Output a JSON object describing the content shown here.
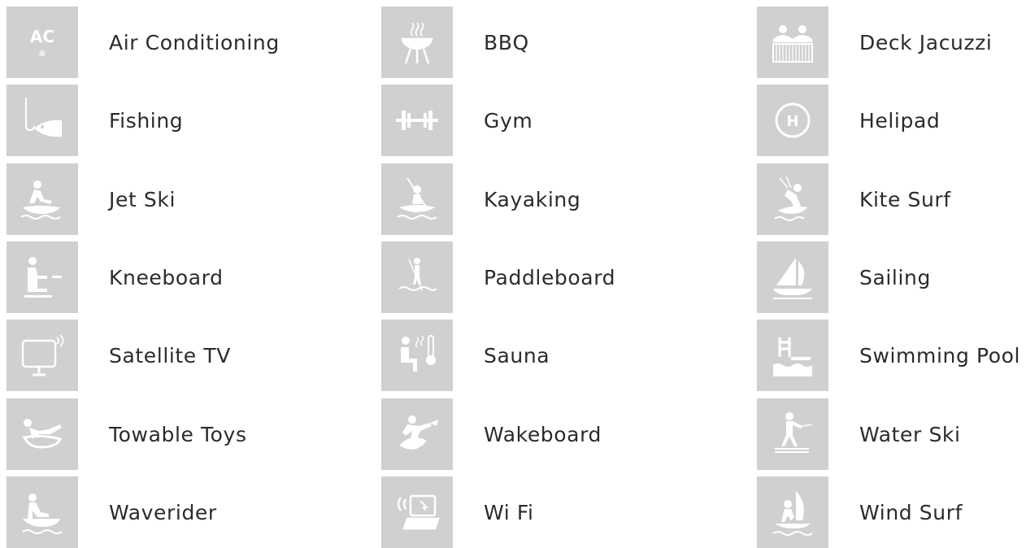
{
  "amenities": [
    {
      "label": "Air Conditioning",
      "icon": "air-conditioning-icon"
    },
    {
      "label": "BBQ",
      "icon": "bbq-icon"
    },
    {
      "label": "Deck Jacuzzi",
      "icon": "deck-jacuzzi-icon"
    },
    {
      "label": "Fishing",
      "icon": "fishing-icon"
    },
    {
      "label": "Gym",
      "icon": "gym-icon"
    },
    {
      "label": "Helipad",
      "icon": "helipad-icon"
    },
    {
      "label": "Jet Ski",
      "icon": "jet-ski-icon"
    },
    {
      "label": "Kayaking",
      "icon": "kayaking-icon"
    },
    {
      "label": "Kite Surf",
      "icon": "kite-surf-icon"
    },
    {
      "label": "Kneeboard",
      "icon": "kneeboard-icon"
    },
    {
      "label": "Paddleboard",
      "icon": "paddleboard-icon"
    },
    {
      "label": "Sailing",
      "icon": "sailing-icon"
    },
    {
      "label": "Satellite TV",
      "icon": "satellite-tv-icon"
    },
    {
      "label": "Sauna",
      "icon": "sauna-icon"
    },
    {
      "label": "Swimming Pool",
      "icon": "swimming-pool-icon"
    },
    {
      "label": "Towable Toys",
      "icon": "towable-toys-icon"
    },
    {
      "label": "Wakeboard",
      "icon": "wakeboard-icon"
    },
    {
      "label": "Water Ski",
      "icon": "water-ski-icon"
    },
    {
      "label": "Waverider",
      "icon": "waverider-icon"
    },
    {
      "label": "Wi Fi",
      "icon": "wifi-icon"
    },
    {
      "label": "Wind Surf",
      "icon": "wind-surf-icon"
    }
  ],
  "colors": {
    "tile": "#d0d0d0",
    "icon": "#ffffff",
    "text": "#2b2b2b"
  }
}
